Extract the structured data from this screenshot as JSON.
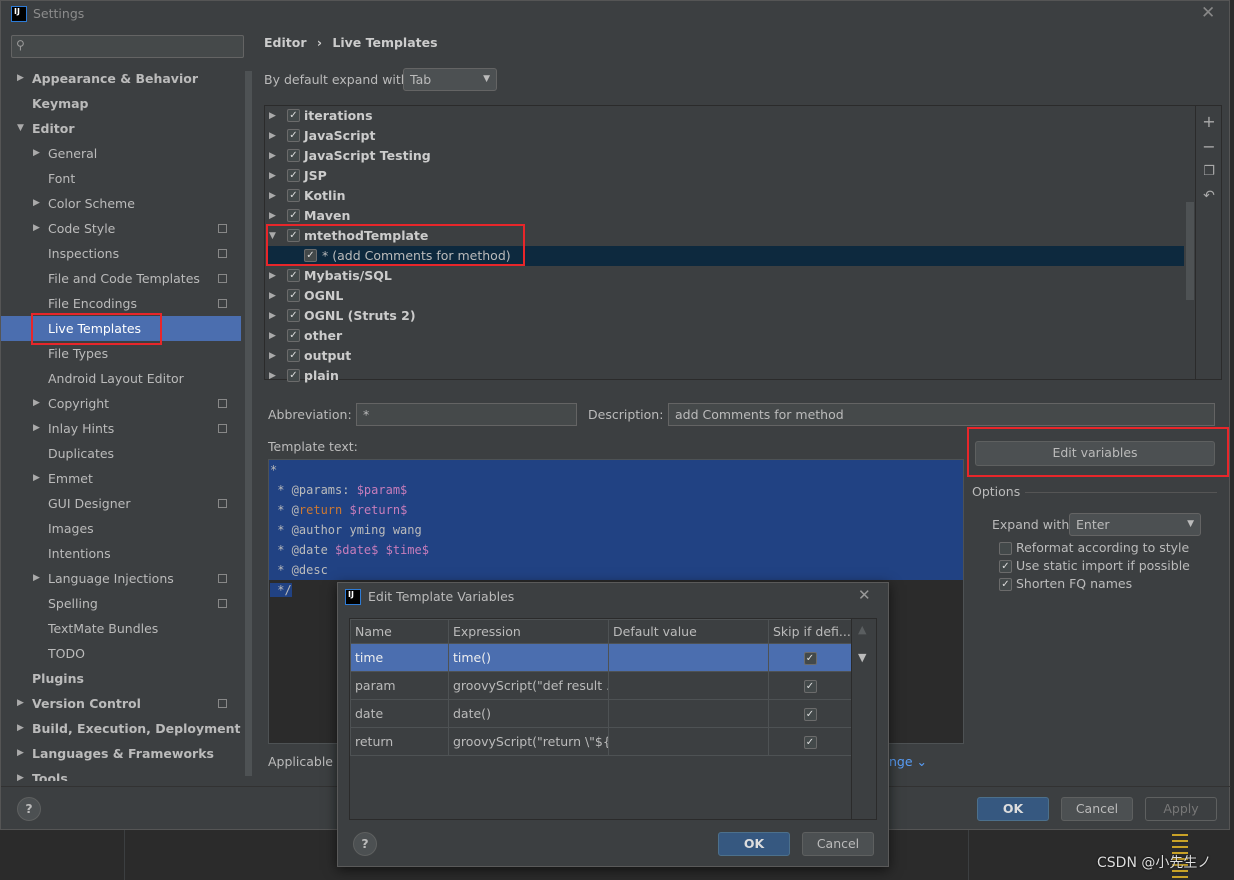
{
  "window": {
    "title": "Settings"
  },
  "sidebar": {
    "items": [
      {
        "label": "Appearance & Behavior",
        "level": 0,
        "bold": true,
        "arrow": "right"
      },
      {
        "label": "Keymap",
        "level": 0,
        "bold": true
      },
      {
        "label": "Editor",
        "level": 0,
        "bold": true,
        "arrow": "down"
      },
      {
        "label": "General",
        "level": 1,
        "arrow": "right"
      },
      {
        "label": "Font",
        "level": 1
      },
      {
        "label": "Color Scheme",
        "level": 1,
        "arrow": "right"
      },
      {
        "label": "Code Style",
        "level": 1,
        "arrow": "right",
        "copy": true
      },
      {
        "label": "Inspections",
        "level": 1,
        "copy": true
      },
      {
        "label": "File and Code Templates",
        "level": 1,
        "copy": true
      },
      {
        "label": "File Encodings",
        "level": 1,
        "copy": true
      },
      {
        "label": "Live Templates",
        "level": 1,
        "selected": true
      },
      {
        "label": "File Types",
        "level": 1
      },
      {
        "label": "Android Layout Editor",
        "level": 1
      },
      {
        "label": "Copyright",
        "level": 1,
        "arrow": "right",
        "copy": true
      },
      {
        "label": "Inlay Hints",
        "level": 1,
        "arrow": "right",
        "copy": true
      },
      {
        "label": "Duplicates",
        "level": 1
      },
      {
        "label": "Emmet",
        "level": 1,
        "arrow": "right"
      },
      {
        "label": "GUI Designer",
        "level": 1,
        "copy": true
      },
      {
        "label": "Images",
        "level": 1
      },
      {
        "label": "Intentions",
        "level": 1
      },
      {
        "label": "Language Injections",
        "level": 1,
        "arrow": "right",
        "copy": true
      },
      {
        "label": "Spelling",
        "level": 1,
        "copy": true
      },
      {
        "label": "TextMate Bundles",
        "level": 1
      },
      {
        "label": "TODO",
        "level": 1
      },
      {
        "label": "Plugins",
        "level": 0,
        "bold": true
      },
      {
        "label": "Version Control",
        "level": 0,
        "bold": true,
        "arrow": "right",
        "copy": true
      },
      {
        "label": "Build, Execution, Deployment",
        "level": 0,
        "bold": true,
        "arrow": "right"
      },
      {
        "label": "Languages & Frameworks",
        "level": 0,
        "bold": true,
        "arrow": "right"
      },
      {
        "label": "Tools",
        "level": 0,
        "bold": true,
        "arrow": "right"
      }
    ]
  },
  "breadcrumb": {
    "parent": "Editor",
    "sep": "›",
    "current": "Live Templates"
  },
  "expand": {
    "label": "By default expand with",
    "value": "Tab"
  },
  "groups": [
    {
      "label": "iterations",
      "bold": true,
      "expanded": false
    },
    {
      "label": "JavaScript",
      "bold": true,
      "expanded": false
    },
    {
      "label": "JavaScript Testing",
      "bold": true,
      "expanded": false
    },
    {
      "label": "JSP",
      "bold": true,
      "expanded": false
    },
    {
      "label": "Kotlin",
      "bold": true,
      "expanded": false
    },
    {
      "label": "Maven",
      "bold": true,
      "expanded": false
    },
    {
      "label": "mtethodTemplate",
      "bold": true,
      "expanded": true
    },
    {
      "label": "* (add Comments for method)",
      "child": true,
      "selected": true
    },
    {
      "label": "Mybatis/SQL",
      "bold": true,
      "expanded": false
    },
    {
      "label": "OGNL",
      "bold": true,
      "expanded": false
    },
    {
      "label": "OGNL (Struts 2)",
      "bold": true,
      "expanded": false
    },
    {
      "label": "other",
      "bold": true,
      "expanded": false
    },
    {
      "label": "output",
      "bold": true,
      "expanded": false
    },
    {
      "label": "plain",
      "bold": true,
      "expanded": false
    }
  ],
  "tree_toolbar": [
    "plus-icon",
    "minus-icon",
    "copy-icon",
    "undo-icon"
  ],
  "abbreviation": {
    "label": "Abbreviation:",
    "value": "*"
  },
  "description": {
    "label": "Description:",
    "value": "add Comments for method"
  },
  "template_text": {
    "label": "Template text:",
    "lines": [
      [
        {
          "t": "*"
        }
      ],
      [
        {
          "t": " * @params: "
        },
        {
          "t": "$param$",
          "c": "var"
        }
      ],
      [
        {
          "t": " * @"
        },
        {
          "t": "return",
          "c": "kw"
        },
        {
          "t": " "
        },
        {
          "t": "$return$",
          "c": "var"
        }
      ],
      [
        {
          "t": " * @author yming wang"
        }
      ],
      [
        {
          "t": " * @date "
        },
        {
          "t": "$date$",
          "c": "var"
        },
        {
          "t": " "
        },
        {
          "t": "$time$",
          "c": "var"
        }
      ],
      [
        {
          "t": " * @desc"
        }
      ],
      [
        {
          "t": " */"
        }
      ]
    ]
  },
  "edit_variables": "Edit variables",
  "options": {
    "title": "Options",
    "expand_label": "Expand with",
    "expand_value": "Enter",
    "checks": [
      {
        "label": "Reformat according to style",
        "checked": false
      },
      {
        "label": "Use static import if possible",
        "checked": true
      },
      {
        "label": "Shorten FQ names",
        "checked": true
      }
    ]
  },
  "applicable": {
    "label": "Applicable i",
    "change": "nge"
  },
  "footer": {
    "ok": "OK",
    "cancel": "Cancel",
    "apply": "Apply"
  },
  "dialog": {
    "title": "Edit Template Variables",
    "columns": [
      "Name",
      "Expression",
      "Default value",
      "Skip if defi..."
    ],
    "rows": [
      {
        "name": "time",
        "expression": "time()",
        "default": "",
        "skip": true,
        "selected": true
      },
      {
        "name": "param",
        "expression": "groovyScript(\"def result ...",
        "default": "",
        "skip": true
      },
      {
        "name": "date",
        "expression": "date()",
        "default": "",
        "skip": true
      },
      {
        "name": "return",
        "expression": "groovyScript(\"return \\\"${...",
        "default": "",
        "skip": true
      }
    ],
    "ok": "OK",
    "cancel": "Cancel"
  },
  "watermark": "CSDN @小先生ノ"
}
